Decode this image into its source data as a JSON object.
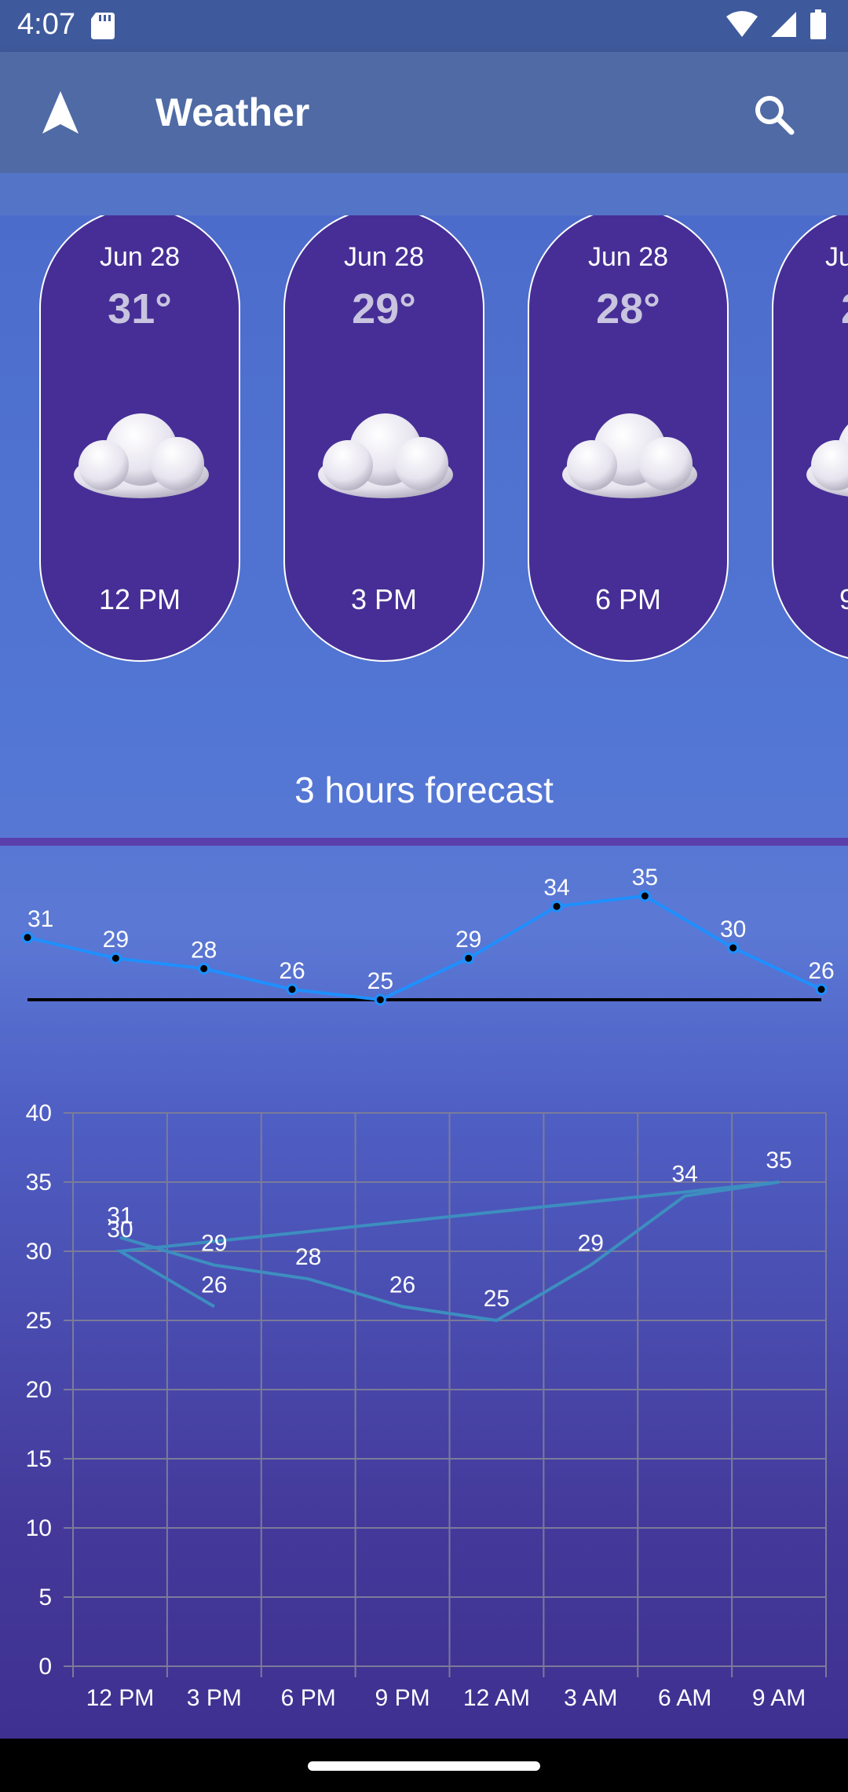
{
  "status": {
    "time": "4:07"
  },
  "app_bar": {
    "title": "Weather"
  },
  "cards": [
    {
      "date": "Jun 28",
      "temp": "31°",
      "time": "12 PM"
    },
    {
      "date": "Jun 28",
      "temp": "29°",
      "time": "3 PM"
    },
    {
      "date": "Jun 28",
      "temp": "28°",
      "time": "6 PM"
    },
    {
      "date": "Ju",
      "temp": "2",
      "time": "9"
    }
  ],
  "forecast": {
    "title": "3 hours forecast"
  },
  "chart_data": [
    {
      "type": "line",
      "labels": [
        "31",
        "29",
        "28",
        "26",
        "25",
        "29",
        "34",
        "35",
        "30",
        "26"
      ],
      "values": [
        31,
        29,
        28,
        26,
        25,
        29,
        34,
        35,
        30,
        26
      ],
      "line_color": "#1e90ff",
      "baseline_color": "#000000"
    },
    {
      "type": "line",
      "categories": [
        "12 PM",
        "3 PM",
        "6 PM",
        "9 PM",
        "12 AM",
        "3 AM",
        "6 AM",
        "9 AM"
      ],
      "yticks": [
        "40",
        "35",
        "30",
        "25",
        "20",
        "15",
        "10",
        "5",
        "0"
      ],
      "ylim": [
        0,
        40
      ],
      "series": [
        {
          "points": [
            [
              0,
              31
            ],
            [
              1,
              29
            ],
            [
              2,
              28
            ],
            [
              3,
              26
            ],
            [
              4,
              25
            ],
            [
              5,
              29
            ],
            [
              6,
              34
            ],
            [
              7,
              35
            ]
          ]
        },
        {
          "points": [
            [
              7,
              35
            ],
            [
              0,
              30
            ],
            [
              1,
              26
            ]
          ]
        }
      ],
      "labels": [
        {
          "text": "31",
          "cat": 0,
          "y": 31
        },
        {
          "text": "30",
          "cat": 0,
          "y": 30
        },
        {
          "text": "26",
          "cat": 1,
          "y": 26
        },
        {
          "text": "29",
          "cat": 1,
          "y": 29
        },
        {
          "text": "28",
          "cat": 2,
          "y": 28
        },
        {
          "text": "26",
          "cat": 3,
          "y": 26
        },
        {
          "text": "25",
          "cat": 4,
          "y": 25
        },
        {
          "text": "29",
          "cat": 5,
          "y": 29
        },
        {
          "text": "34",
          "cat": 6,
          "y": 34
        },
        {
          "text": "35",
          "cat": 7,
          "y": 35
        }
      ],
      "line_color": "#3d8ec0",
      "grid": true
    }
  ]
}
